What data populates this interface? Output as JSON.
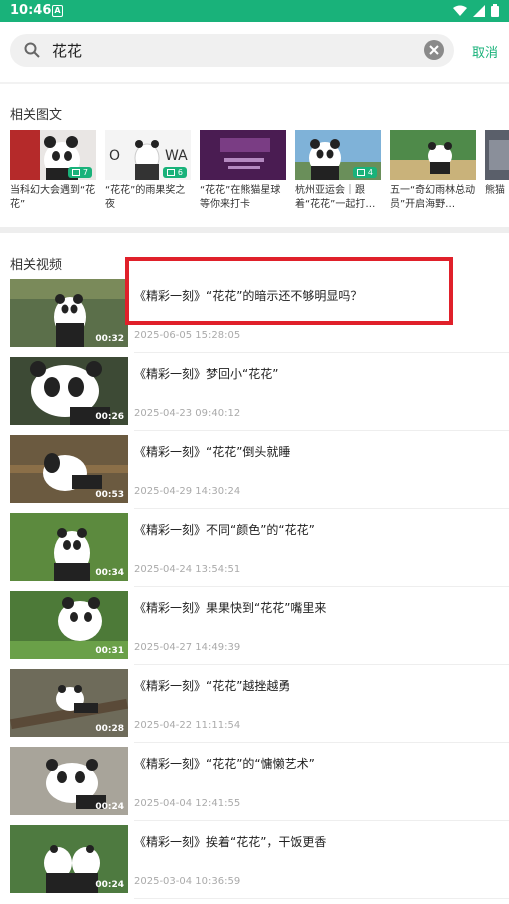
{
  "status_bar": {
    "time": "10:46",
    "app_icon_letter": "A"
  },
  "search": {
    "query": "花花",
    "cancel_label": "取消"
  },
  "articles_section": {
    "title": "相关图文",
    "items": [
      {
        "caption": "当科幻大会遇到“花花”",
        "badge": "7",
        "icon": "image-icon"
      },
      {
        "caption": "“花花”的雨果奖之夜",
        "badge": "6",
        "icon": "image-icon"
      },
      {
        "caption": "“花花”在熊猫星球等你来打卡",
        "badge": "",
        "icon": ""
      },
      {
        "caption": "杭州亚运会｜跟着“花花”一起打…",
        "badge": "4",
        "icon": "image-icon"
      },
      {
        "caption": "五一“奇幻雨林总动员”开启海野…",
        "badge": "",
        "icon": ""
      },
      {
        "caption": "熊猫｜大",
        "badge": "",
        "icon": ""
      }
    ]
  },
  "videos_section": {
    "title": "相关视频",
    "items": [
      {
        "title": "《精彩一刻》“花花”的暗示还不够明显吗？",
        "date": "2025-06-05 15:28:05",
        "duration": "00:32"
      },
      {
        "title": "《精彩一刻》梦回小“花花”",
        "date": "2025-04-23 09:40:12",
        "duration": "00:26"
      },
      {
        "title": "《精彩一刻》“花花”倒头就睡",
        "date": "2025-04-29 14:30:24",
        "duration": "00:53"
      },
      {
        "title": "《精彩一刻》不同“颜色”的“花花”",
        "date": "2025-04-24 13:54:51",
        "duration": "00:34"
      },
      {
        "title": "《精彩一刻》果果快到“花花”嘴里来",
        "date": "2025-04-27 14:49:39",
        "duration": "00:31"
      },
      {
        "title": "《精彩一刻》“花花”越挫越勇",
        "date": "2025-04-22 11:11:54",
        "duration": "00:28"
      },
      {
        "title": "《精彩一刻》“花花”的“慵懒艺术”",
        "date": "2025-04-04 12:41:55",
        "duration": "00:24"
      },
      {
        "title": "《精彩一刻》挨着“花花”，干饭更香",
        "date": "2025-03-04 10:36:59",
        "duration": "00:24"
      }
    ]
  },
  "colors": {
    "accent": "#19b27a",
    "highlight": "#e0202a"
  }
}
